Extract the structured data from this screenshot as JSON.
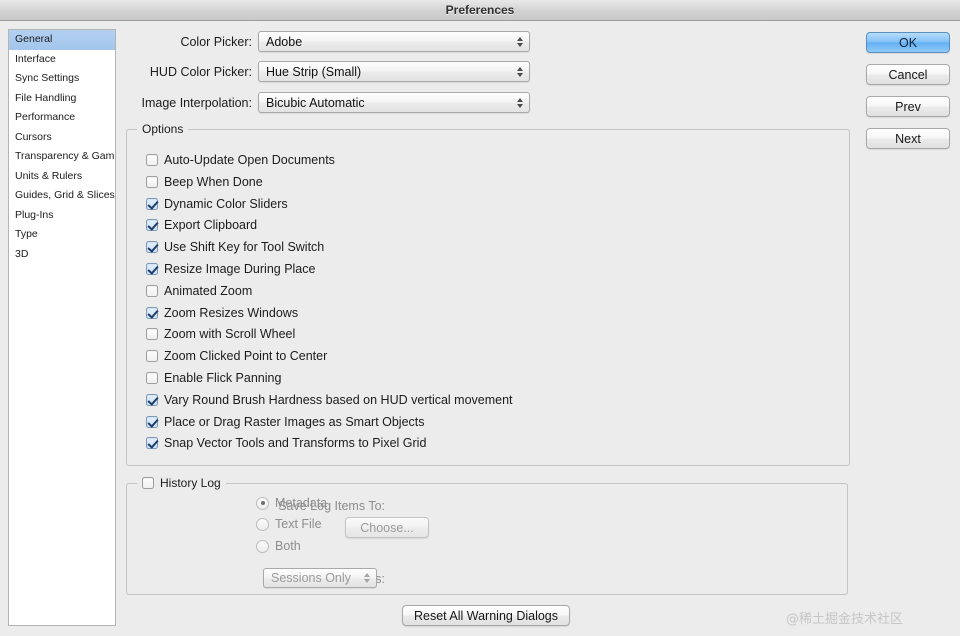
{
  "window": {
    "title": "Preferences"
  },
  "sidebar": {
    "items": [
      {
        "label": "General",
        "selected": true
      },
      {
        "label": "Interface",
        "selected": false
      },
      {
        "label": "Sync Settings",
        "selected": false
      },
      {
        "label": "File Handling",
        "selected": false
      },
      {
        "label": "Performance",
        "selected": false
      },
      {
        "label": "Cursors",
        "selected": false
      },
      {
        "label": "Transparency & Gamut",
        "selected": false
      },
      {
        "label": "Units & Rulers",
        "selected": false
      },
      {
        "label": "Guides, Grid & Slices",
        "selected": false
      },
      {
        "label": "Plug-Ins",
        "selected": false
      },
      {
        "label": "Type",
        "selected": false
      },
      {
        "label": "3D",
        "selected": false
      }
    ]
  },
  "fields": {
    "color_picker": {
      "label": "Color Picker:",
      "value": "Adobe"
    },
    "hud_color_picker": {
      "label": "HUD Color Picker:",
      "value": "Hue Strip (Small)"
    },
    "image_interpolation": {
      "label": "Image Interpolation:",
      "value": "Bicubic Automatic"
    }
  },
  "options": {
    "title": "Options",
    "items": [
      {
        "label": "Auto-Update Open Documents",
        "checked": false
      },
      {
        "label": "Beep When Done",
        "checked": false
      },
      {
        "label": "Dynamic Color Sliders",
        "checked": true
      },
      {
        "label": "Export Clipboard",
        "checked": true
      },
      {
        "label": "Use Shift Key for Tool Switch",
        "checked": true
      },
      {
        "label": "Resize Image During Place",
        "checked": true
      },
      {
        "label": "Animated Zoom",
        "checked": false
      },
      {
        "label": "Zoom Resizes Windows",
        "checked": true
      },
      {
        "label": "Zoom with Scroll Wheel",
        "checked": false
      },
      {
        "label": "Zoom Clicked Point to Center",
        "checked": false
      },
      {
        "label": "Enable Flick Panning",
        "checked": false
      },
      {
        "label": "Vary Round Brush Hardness based on HUD vertical movement",
        "checked": true
      },
      {
        "label": "Place or Drag Raster Images as Smart Objects",
        "checked": true
      },
      {
        "label": "Snap Vector Tools and Transforms to Pixel Grid",
        "checked": true
      }
    ]
  },
  "history_log": {
    "title": "History Log",
    "enabled": false,
    "save_log_items_label": "Save Log Items To:",
    "radios": [
      {
        "label": "Metadata",
        "selected": true
      },
      {
        "label": "Text File",
        "selected": false
      },
      {
        "label": "Both",
        "selected": false
      }
    ],
    "choose_button": "Choose...",
    "edit_log_items_label": "Edit Log Items:",
    "edit_log_items_value": "Sessions Only"
  },
  "buttons": {
    "ok": "OK",
    "cancel": "Cancel",
    "prev": "Prev",
    "next": "Next",
    "reset_all_warning_dialogs": "Reset All Warning Dialogs"
  },
  "watermark": {
    "text": "@稀土掘金技术社区"
  },
  "colors": {
    "window_bg": "#ececec",
    "selection_blue": "#a8c9ef",
    "default_button_blue": "#63aff2",
    "checkbox_check": "#1d3d6b",
    "disabled_text": "#8d8d8d"
  }
}
